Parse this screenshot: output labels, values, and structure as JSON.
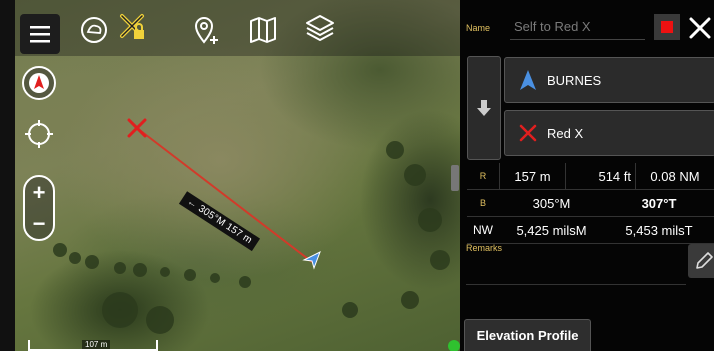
{
  "map": {
    "scale_label": "107 m",
    "line_label": "← 305°M 157 m",
    "toolbar_icons": [
      "menu-icon",
      "compass-brain-icon",
      "locked-x-icon",
      "add-marker-icon",
      "map-icon",
      "layers-icon"
    ],
    "side_icons": [
      "north-arrow-icon",
      "crosshair-icon"
    ],
    "zoom_in": "+",
    "zoom_out": "−"
  },
  "panel": {
    "name_label": "Name",
    "name_placeholder": "Self to Red X",
    "from_point": "BURNES",
    "to_point": "Red X",
    "range_label": "R",
    "range_m": "157 m",
    "range_ft": "514 ft",
    "range_nm": "0.08 NM",
    "bearing_label": "B",
    "bearing_mag": "305°M",
    "bearing_true": "307°T",
    "nw_label": "NW",
    "mils_mag": "5,425 milsM",
    "mils_true": "5,453 milsT",
    "remarks_label": "Remarks",
    "elevation_button": "Elevation Profile"
  },
  "colors": {
    "accent_label": "#e0c060",
    "route_line": "#d23a2a",
    "red_x": "#e11f1f",
    "self_marker": "#4a90e2"
  }
}
